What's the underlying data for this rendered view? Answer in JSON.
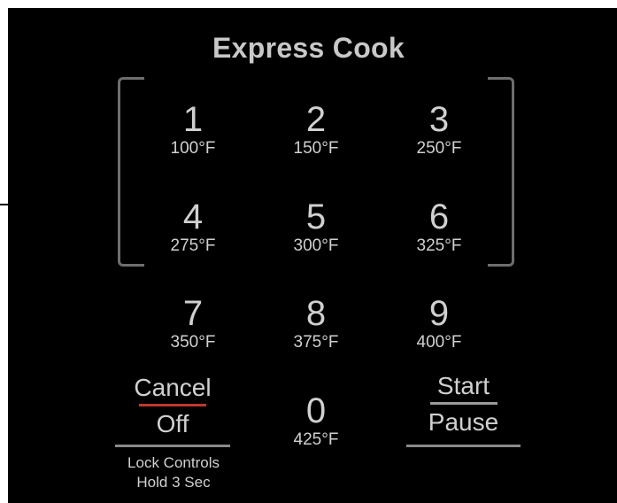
{
  "title": "Express Cook",
  "keys": [
    {
      "num": "1",
      "temp": "100°F"
    },
    {
      "num": "2",
      "temp": "150°F"
    },
    {
      "num": "3",
      "temp": "250°F"
    },
    {
      "num": "4",
      "temp": "275°F"
    },
    {
      "num": "5",
      "temp": "300°F"
    },
    {
      "num": "6",
      "temp": "325°F"
    },
    {
      "num": "7",
      "temp": "350°F"
    },
    {
      "num": "8",
      "temp": "375°F"
    },
    {
      "num": "9",
      "temp": "400°F"
    },
    {
      "num": "0",
      "temp": "425°F"
    }
  ],
  "cancel": {
    "top": "Cancel",
    "bottom": "Off",
    "divider_color": "#c0392b"
  },
  "start": {
    "top": "Start",
    "bottom": "Pause"
  },
  "lock": {
    "line1": "Lock Controls",
    "line2": "Hold 3 Sec"
  },
  "colors": {
    "panel": "#000000",
    "text": "#d0d0d0",
    "bracket": "#6e6e6e"
  }
}
